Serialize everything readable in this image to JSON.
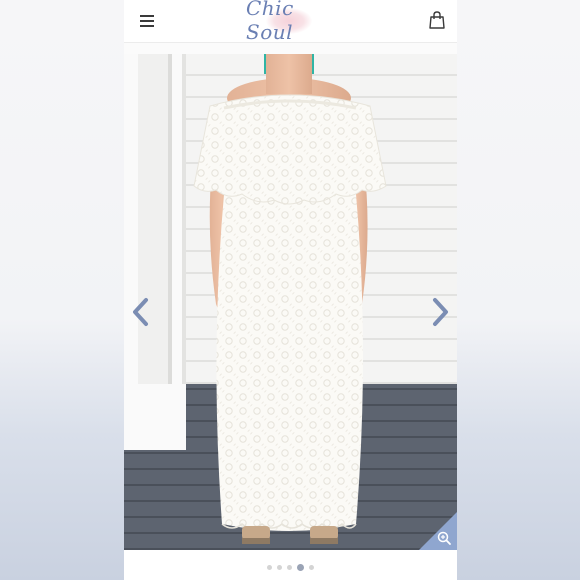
{
  "header": {
    "brand": "Chic Soul",
    "menu_icon": "hamburger-menu-icon",
    "cart_icon": "shopping-bag-icon"
  },
  "product_gallery": {
    "image_description_icon": "product-photo",
    "prev_icon": "chevron-left-icon",
    "next_icon": "chevron-right-icon",
    "zoom_icon": "magnifier-plus-icon",
    "slide_count": 5,
    "active_slide": 4
  },
  "colors": {
    "brand": "#6a7fb3",
    "arrow": "#7b8db3",
    "zoom_corner": "#8fa6cf",
    "active_dot": "#9aa3b5"
  }
}
